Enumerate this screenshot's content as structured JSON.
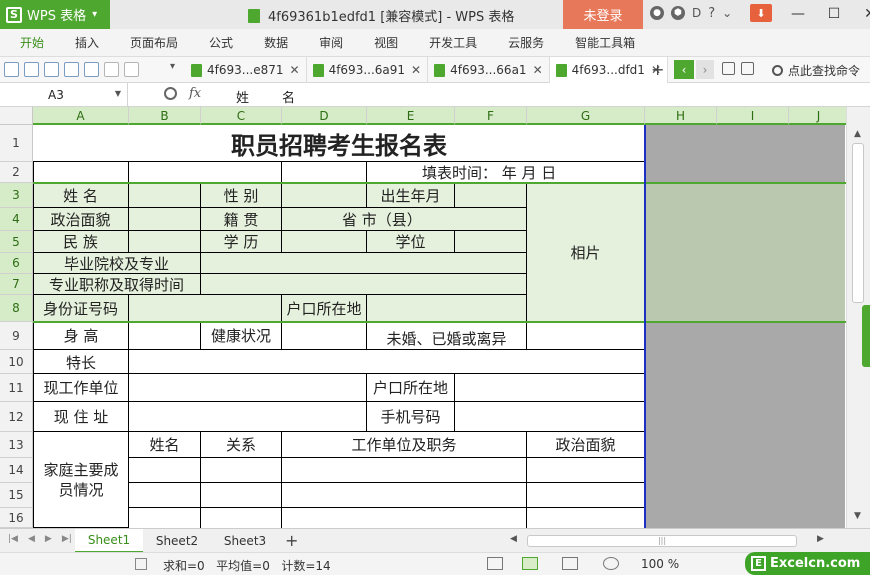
{
  "titlebar": {
    "app_name": "WPS 表格",
    "doc_title": "4f69361b1edfd1 [兼容模式] - WPS 表格",
    "login_label": "未登录",
    "help": "?"
  },
  "ribbon_tabs": [
    "开始",
    "插入",
    "页面布局",
    "公式",
    "数据",
    "审阅",
    "视图",
    "开发工具",
    "云服务",
    "智能工具箱"
  ],
  "file_tabs": [
    {
      "label": "4f693...e871"
    },
    {
      "label": "4f693...6a91"
    },
    {
      "label": "4f693...66a1"
    },
    {
      "label": "4f693...dfd1",
      "active": true
    }
  ],
  "find_command": "点此查找命令",
  "formula_bar": {
    "cell_ref": "A3",
    "fx": "fx",
    "content": "姓        名"
  },
  "columns": [
    "A",
    "B",
    "C",
    "D",
    "E",
    "F",
    "G",
    "H",
    "I",
    "J"
  ],
  "rows": [
    "1",
    "2",
    "3",
    "4",
    "5",
    "6",
    "7",
    "8",
    "9",
    "10",
    "11",
    "12",
    "13",
    "14",
    "15",
    "16"
  ],
  "form": {
    "title": "职员招聘考生报名表",
    "fill_time": "填表时间：     年     月     日",
    "name": "姓      名",
    "gender": "性    别",
    "birth": "出生年月",
    "political": "政治面貌",
    "native": "籍    贯",
    "province_city": "省        市（县）",
    "photo": "相片",
    "ethnic": "民      族",
    "education": "学    历",
    "degree": "学位",
    "school": "毕业院校及专业",
    "title_time": "专业职称及取得时间",
    "id_no": "身份证号码",
    "hukou1": "户口所在地",
    "height": "身  高",
    "health": "健康状况",
    "marital": "未婚、已婚或离异",
    "specialty": "特长",
    "work_unit": "现工作单位",
    "hukou2": "户口所在地",
    "address": "现  住  址",
    "mobile": "手机号码",
    "family": "家庭主要成员情况",
    "f_name": "姓名",
    "f_rel": "关系",
    "f_work": "工作单位及职务",
    "f_pol": "政治面貌"
  },
  "sheets": [
    "Sheet1",
    "Sheet2",
    "Sheet3"
  ],
  "add_sheet": "+",
  "status": {
    "sum": "求和=0",
    "avg": "平均值=0",
    "count": "计数=14",
    "zoom": "100 %"
  },
  "watermark": "Excelcn.com",
  "colors": {
    "accent": "#4ea72e",
    "login": "#e8785a",
    "selection": "#e5f1dc"
  }
}
